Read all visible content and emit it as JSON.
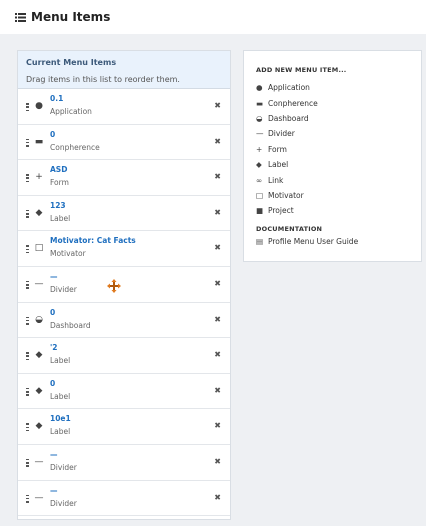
{
  "header": {
    "title": "Menu Items",
    "icon": "list-icon"
  },
  "left": {
    "title": "Current Menu Items",
    "hint": "Drag items in this list to reorder them.",
    "items": [
      {
        "name": "0.1",
        "type": "Application",
        "icon": "globe-icon",
        "glyph": "●"
      },
      {
        "name": "0",
        "type": "Conpherence",
        "icon": "comments-icon",
        "glyph": "▬"
      },
      {
        "name": "ASD",
        "type": "Form",
        "icon": "plus-icon",
        "glyph": "+"
      },
      {
        "name": "123",
        "type": "Label",
        "icon": "tag-icon",
        "glyph": "◆"
      },
      {
        "name": "Motivator: Cat Facts",
        "type": "Motivator",
        "icon": "laptop-icon",
        "glyph": "□"
      },
      {
        "name": "—",
        "type": "Divider",
        "icon": "minus-icon",
        "glyph": "—"
      },
      {
        "name": "0",
        "type": "Dashboard",
        "icon": "dashboard-icon",
        "glyph": "◒"
      },
      {
        "name": "'2",
        "type": "Label",
        "icon": "tag-icon",
        "glyph": "◆"
      },
      {
        "name": "0",
        "type": "Label",
        "icon": "tag-icon",
        "glyph": "◆"
      },
      {
        "name": "10e1",
        "type": "Label",
        "icon": "tag-icon",
        "glyph": "◆"
      },
      {
        "name": "—",
        "type": "Divider",
        "icon": "minus-icon",
        "glyph": "—"
      },
      {
        "name": "—",
        "type": "Divider",
        "icon": "minus-icon",
        "glyph": "—"
      }
    ],
    "remove_glyph": "✖"
  },
  "right": {
    "add_title": "ADD NEW MENU ITEM...",
    "add_items": [
      {
        "label": "Application",
        "icon": "globe-icon",
        "glyph": "●"
      },
      {
        "label": "Conpherence",
        "icon": "comments-icon",
        "glyph": "▬"
      },
      {
        "label": "Dashboard",
        "icon": "dashboard-icon",
        "glyph": "◒"
      },
      {
        "label": "Divider",
        "icon": "minus-icon",
        "glyph": "—"
      },
      {
        "label": "Form",
        "icon": "plus-icon",
        "glyph": "+"
      },
      {
        "label": "Label",
        "icon": "tag-icon",
        "glyph": "◆"
      },
      {
        "label": "Link",
        "icon": "link-icon",
        "glyph": "∞"
      },
      {
        "label": "Motivator",
        "icon": "laptop-icon",
        "glyph": "□"
      },
      {
        "label": "Project",
        "icon": "briefcase-icon",
        "glyph": "■"
      }
    ],
    "doc_title": "DOCUMENTATION",
    "doc_link": {
      "label": "Profile Menu User Guide",
      "icon": "book-icon",
      "glyph": "▤"
    }
  }
}
